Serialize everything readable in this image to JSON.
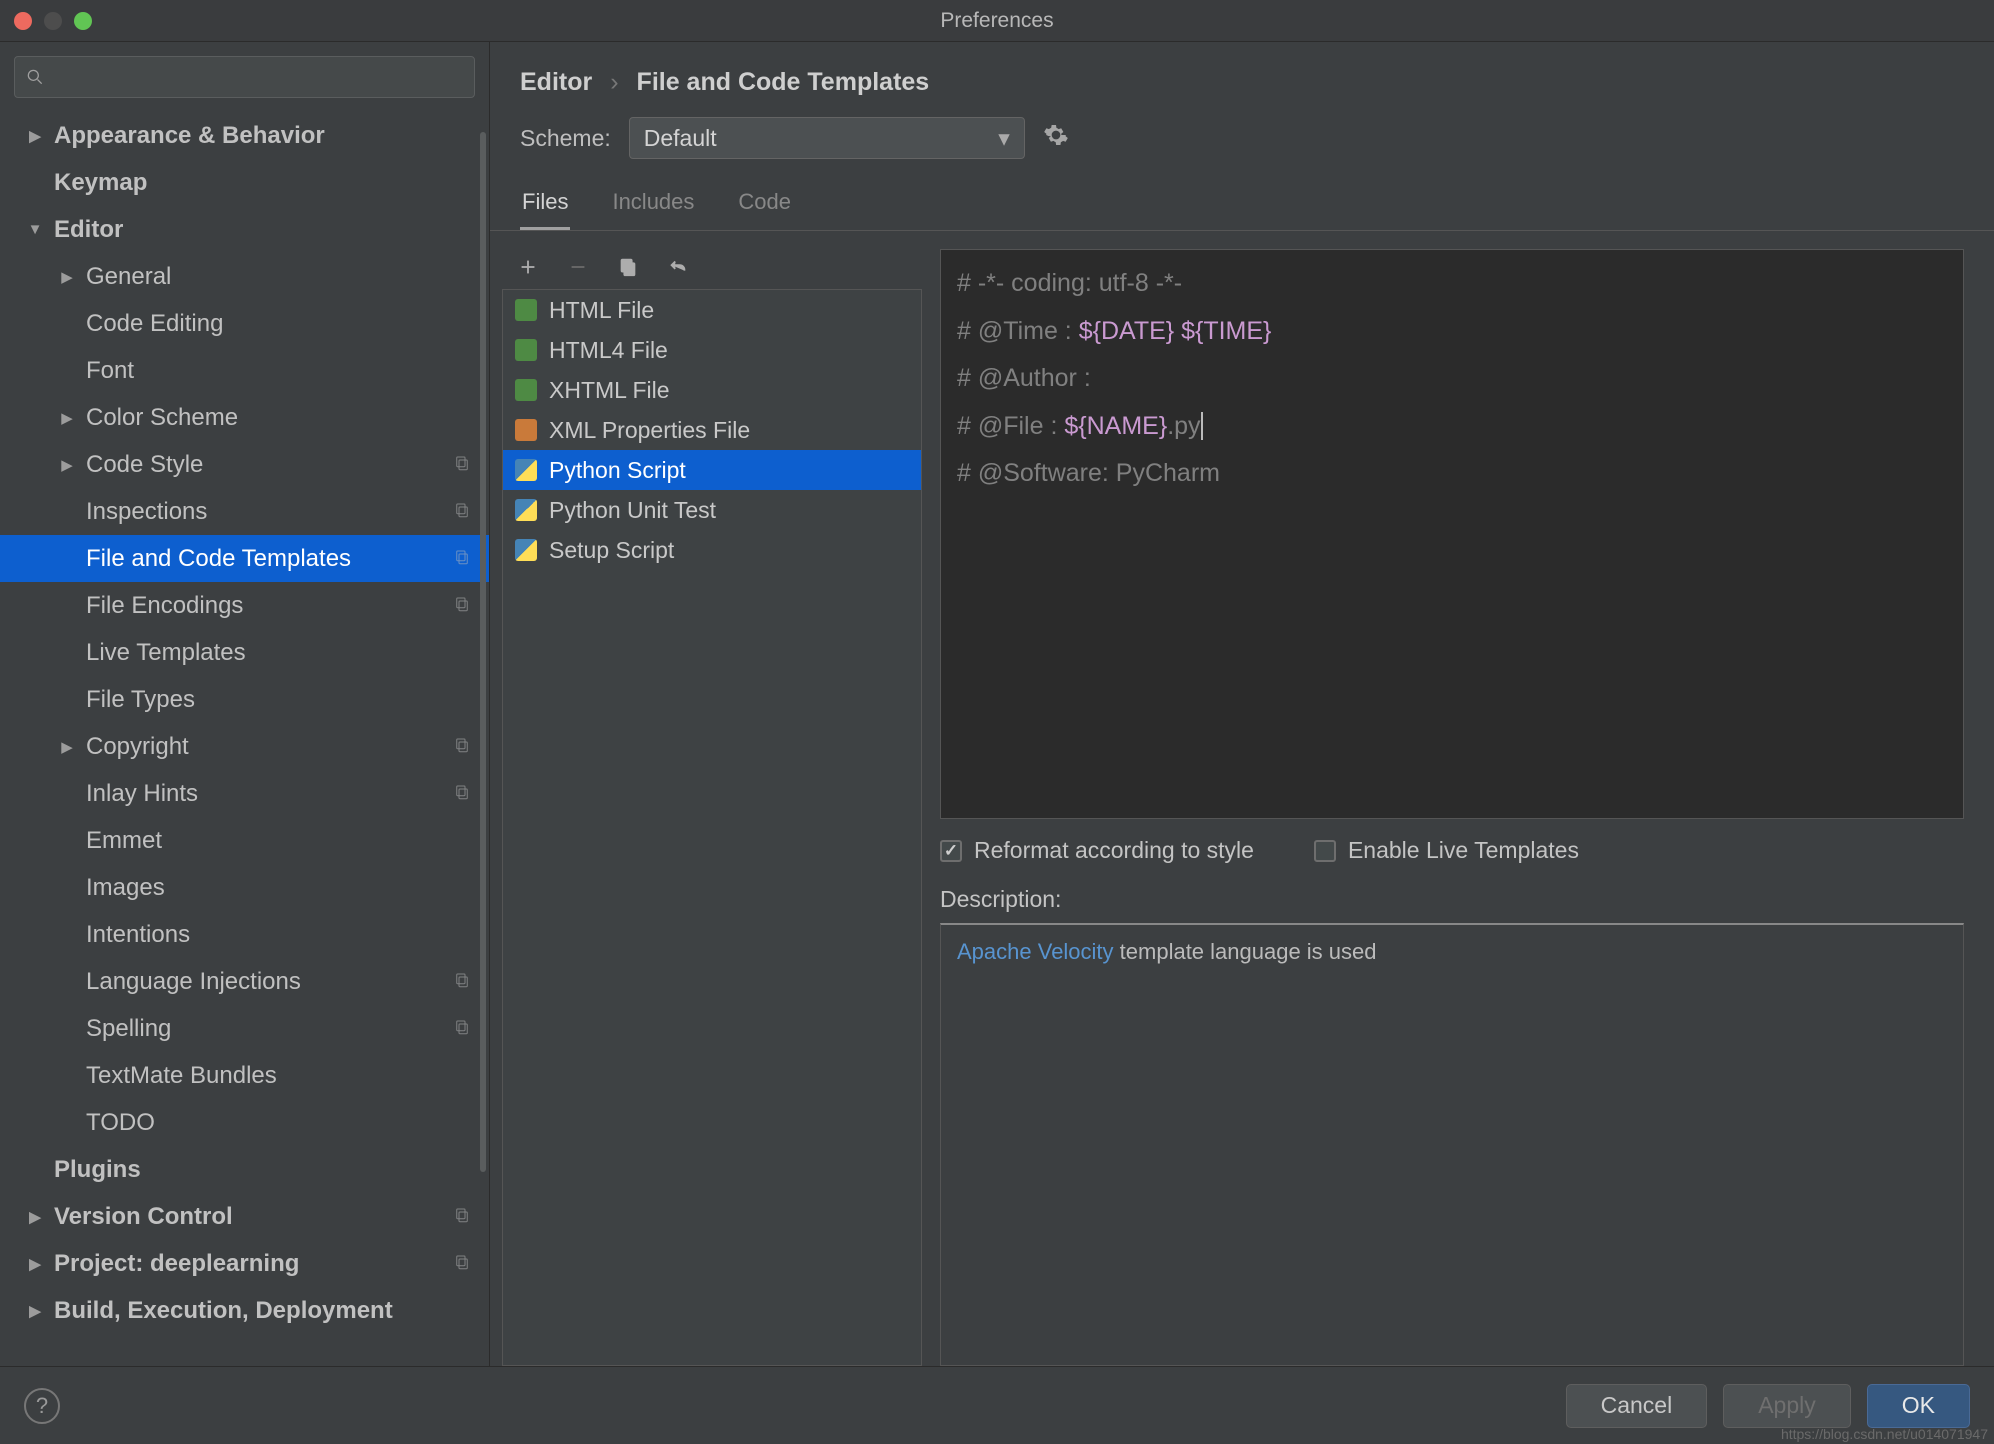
{
  "window": {
    "title": "Preferences"
  },
  "sidebar": {
    "search_placeholder": "",
    "items": [
      {
        "label": "Appearance & Behavior",
        "level": 1,
        "bold": true,
        "arrow": "right",
        "copy": false
      },
      {
        "label": "Keymap",
        "level": 1,
        "bold": true,
        "arrow": "",
        "copy": false
      },
      {
        "label": "Editor",
        "level": 1,
        "bold": true,
        "arrow": "down",
        "copy": false
      },
      {
        "label": "General",
        "level": 2,
        "arrow": "right",
        "copy": false
      },
      {
        "label": "Code Editing",
        "level": 2,
        "arrow": "",
        "copy": false
      },
      {
        "label": "Font",
        "level": 2,
        "arrow": "",
        "copy": false
      },
      {
        "label": "Color Scheme",
        "level": 2,
        "arrow": "right",
        "copy": false
      },
      {
        "label": "Code Style",
        "level": 2,
        "arrow": "right",
        "copy": true
      },
      {
        "label": "Inspections",
        "level": 2,
        "arrow": "",
        "copy": true
      },
      {
        "label": "File and Code Templates",
        "level": 2,
        "arrow": "",
        "copy": true,
        "selected": true
      },
      {
        "label": "File Encodings",
        "level": 2,
        "arrow": "",
        "copy": true
      },
      {
        "label": "Live Templates",
        "level": 2,
        "arrow": "",
        "copy": false
      },
      {
        "label": "File Types",
        "level": 2,
        "arrow": "",
        "copy": false
      },
      {
        "label": "Copyright",
        "level": 2,
        "arrow": "right",
        "copy": true
      },
      {
        "label": "Inlay Hints",
        "level": 2,
        "arrow": "",
        "copy": true
      },
      {
        "label": "Emmet",
        "level": 2,
        "arrow": "",
        "copy": false
      },
      {
        "label": "Images",
        "level": 2,
        "arrow": "",
        "copy": false
      },
      {
        "label": "Intentions",
        "level": 2,
        "arrow": "",
        "copy": false
      },
      {
        "label": "Language Injections",
        "level": 2,
        "arrow": "",
        "copy": true
      },
      {
        "label": "Spelling",
        "level": 2,
        "arrow": "",
        "copy": true
      },
      {
        "label": "TextMate Bundles",
        "level": 2,
        "arrow": "",
        "copy": false
      },
      {
        "label": "TODO",
        "level": 2,
        "arrow": "",
        "copy": false
      },
      {
        "label": "Plugins",
        "level": 1,
        "bold": true,
        "arrow": "",
        "copy": false
      },
      {
        "label": "Version Control",
        "level": 1,
        "bold": true,
        "arrow": "right",
        "copy": true
      },
      {
        "label": "Project: deeplearning",
        "level": 1,
        "bold": true,
        "arrow": "right",
        "copy": true
      },
      {
        "label": "Build, Execution, Deployment",
        "level": 1,
        "bold": true,
        "arrow": "right",
        "copy": false
      }
    ]
  },
  "breadcrumb": {
    "root": "Editor",
    "leaf": "File and Code Templates"
  },
  "scheme": {
    "label": "Scheme:",
    "value": "Default"
  },
  "tabs": [
    "Files",
    "Includes",
    "Code"
  ],
  "active_tab": 0,
  "filelist": [
    {
      "label": "HTML File",
      "icon": "html"
    },
    {
      "label": "HTML4 File",
      "icon": "html"
    },
    {
      "label": "XHTML File",
      "icon": "html"
    },
    {
      "label": "XML Properties File",
      "icon": "xml"
    },
    {
      "label": "Python Script",
      "icon": "py",
      "selected": true
    },
    {
      "label": "Python Unit Test",
      "icon": "py"
    },
    {
      "label": "Setup Script",
      "icon": "py"
    }
  ],
  "editor_lines": [
    {
      "pre": "# -*- coding: utf-8 -*-",
      "var": "",
      "post": ""
    },
    {
      "pre": "# @Time : ",
      "var": "${DATE} ${TIME}",
      "post": ""
    },
    {
      "pre": "# @Author : ",
      "var": "",
      "post": ""
    },
    {
      "pre": "# @File : ",
      "var": "${NAME}",
      "post": ".py",
      "cursor": true
    },
    {
      "pre": "# @Software: PyCharm",
      "var": "",
      "post": ""
    }
  ],
  "checks": {
    "reformat": {
      "label": "Reformat according to style",
      "checked": true
    },
    "live": {
      "label": "Enable Live Templates",
      "checked": false
    }
  },
  "description": {
    "label": "Description:",
    "link_text": "Apache Velocity",
    "text": " template language is used"
  },
  "footer": {
    "cancel": "Cancel",
    "apply": "Apply",
    "ok": "OK"
  },
  "watermark": "https://blog.csdn.net/u014071947"
}
